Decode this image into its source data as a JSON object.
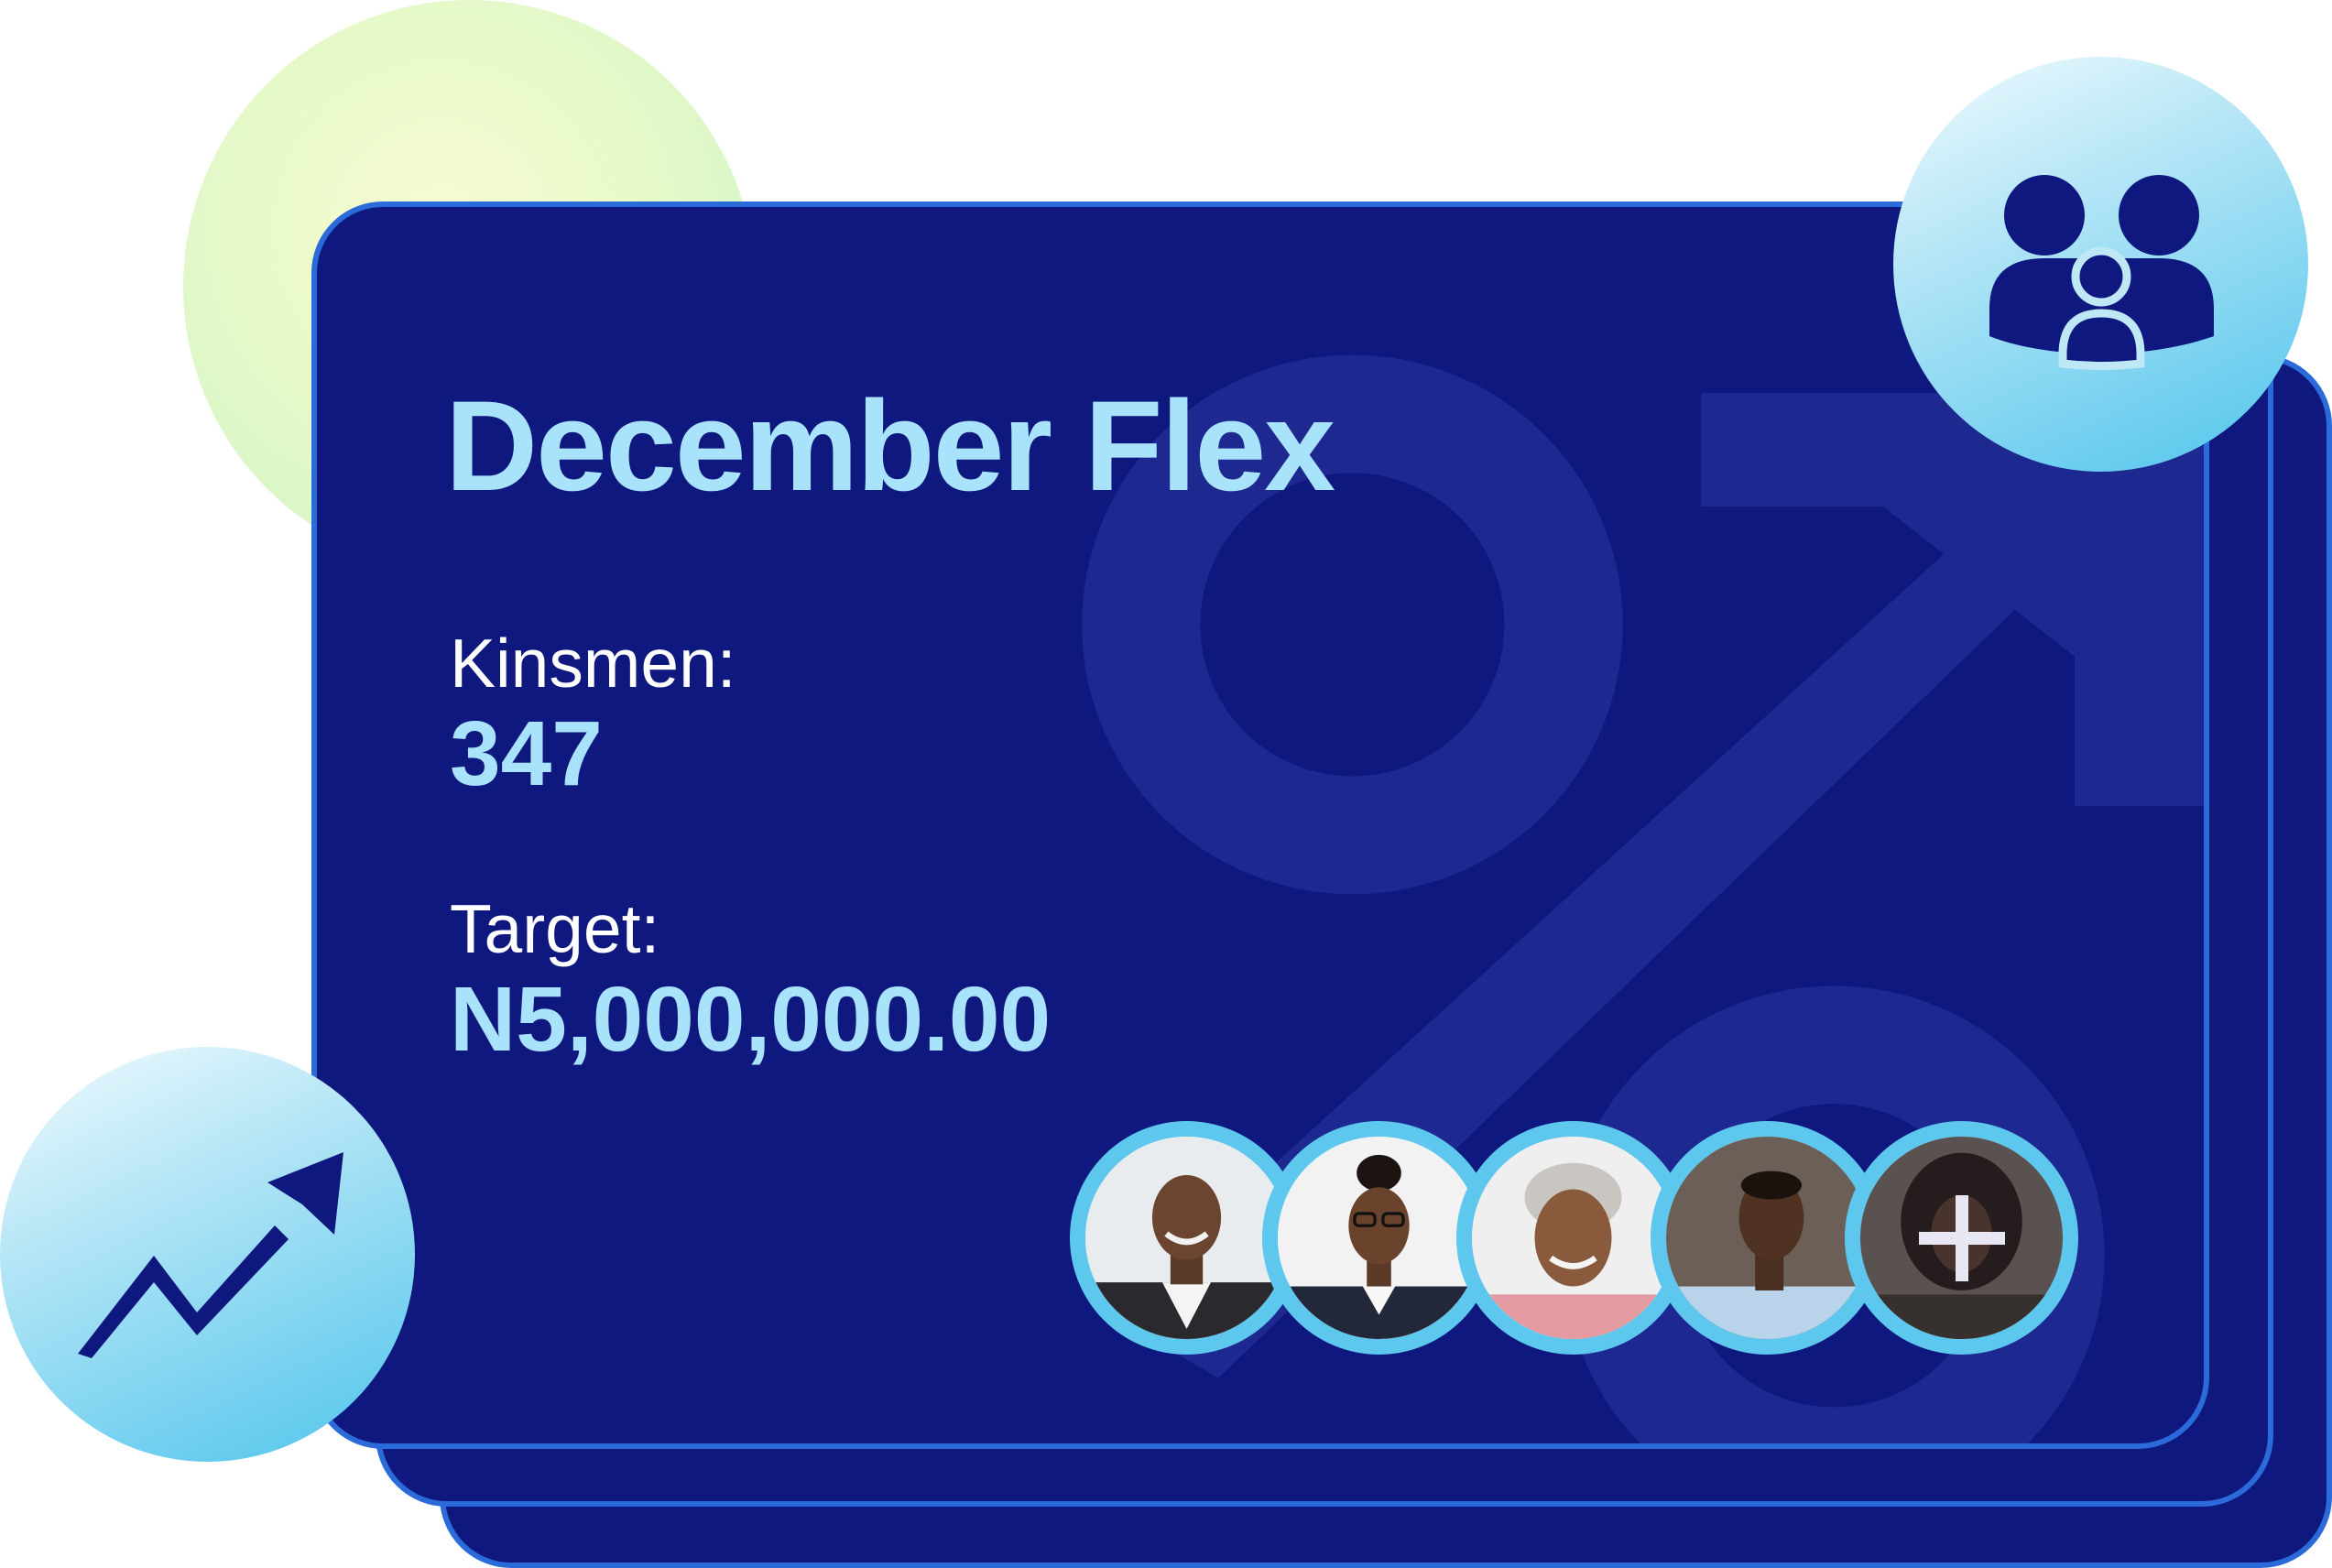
{
  "card": {
    "title": "December Flex",
    "kinsmen_label": "Kinsmen:",
    "kinsmen_value": "347",
    "target_label": "Target:",
    "target_value": "N5,000,000.00"
  },
  "members": {
    "avatars": [
      "member-avatar-1",
      "member-avatar-2",
      "member-avatar-3",
      "member-avatar-4"
    ],
    "add_icon": "plus-icon"
  },
  "icons": {
    "top_right": "family-icon",
    "bottom_left": "trend-up-icon",
    "watermark": "percent-icon"
  },
  "colors": {
    "card_background": "#0f187f",
    "card_border": "#2b6ad9",
    "accent_text": "#a9e3fb",
    "bubble_accent": "#4fc4ec",
    "icon_color": "#0f187f"
  }
}
